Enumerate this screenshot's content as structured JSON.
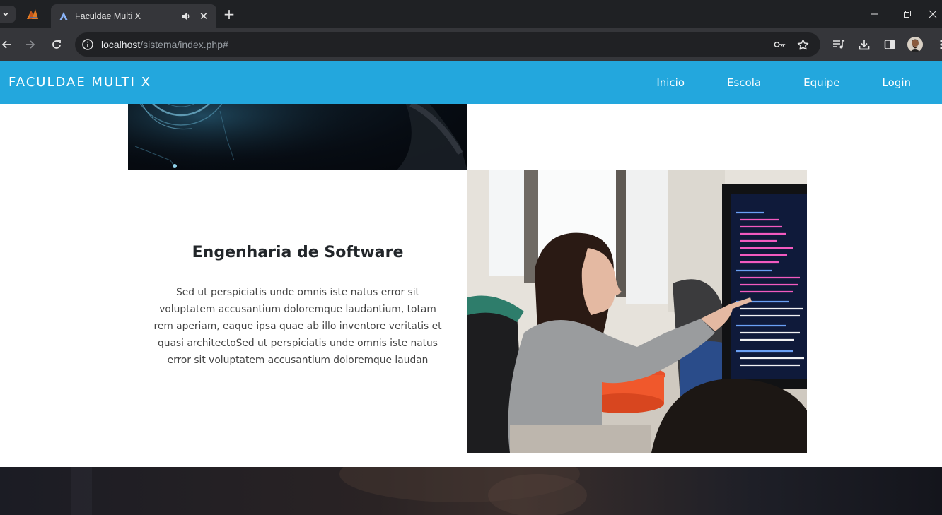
{
  "browser": {
    "tab_title": "Faculdae Multi X",
    "url_host": "localhost",
    "url_path": "/sistema/index.php#",
    "tab_close_glyph": "✕",
    "new_tab_glyph": "+"
  },
  "site": {
    "brand": "FACULDAE MULTI X",
    "nav": [
      "Inicio",
      "Escola",
      "Equipe",
      "Login"
    ],
    "accent_color": "#23a7dd"
  },
  "section": {
    "title": "Engenharia de Software",
    "body": "Sed ut perspiciatis unde omnis iste natus error sit voluptatem accusantium doloremque laudantium, totam rem aperiam, eaque ipsa quae ab illo inventore veritatis et quasi architectoSed ut perspiciatis unde omnis iste natus error sit voluptatem accusantium doloremque laudan"
  },
  "icons": {
    "tab_search": "chevron-down-icon",
    "back": "arrow-left-icon",
    "forward": "arrow-right-icon",
    "reload": "reload-icon",
    "site_info": "info-icon",
    "password": "key-icon",
    "bookmark": "star-icon",
    "media": "media-control-icon",
    "downloads": "download-icon",
    "side_panel": "side-panel-icon",
    "menu": "more-vert-icon"
  }
}
